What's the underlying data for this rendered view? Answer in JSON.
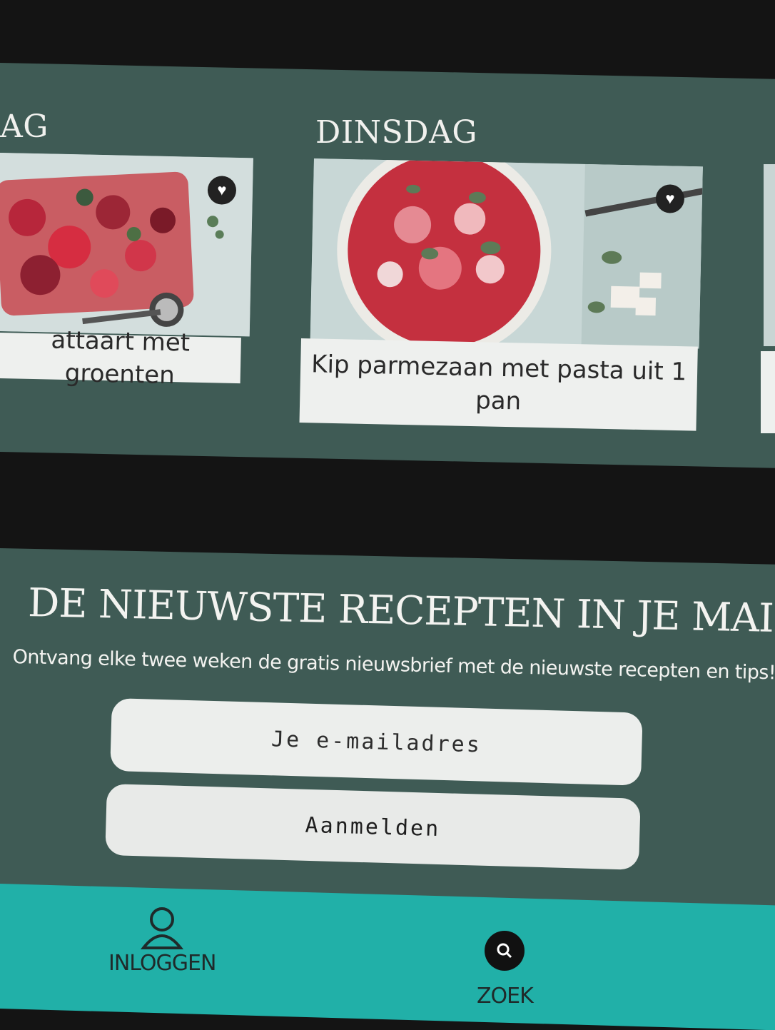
{
  "days": [
    {
      "label": "AG",
      "recipe_title": "attaart met groenten"
    },
    {
      "label": "DINSDAG",
      "recipe_title": "Kip parmezaan met pasta uit 1 pan"
    }
  ],
  "icons": {
    "favorite": "heart-icon",
    "login": "user-icon",
    "search": "search-icon"
  },
  "newsletter": {
    "title": "DE NIEUWSTE RECEPTEN IN JE MAIL?",
    "subtitle": "Ontvang elke twee weken de gratis nieuwsbrief met de nieuwste recepten en tips!",
    "email_placeholder": "Je e-mailadres",
    "submit_label": "Aanmelden"
  },
  "bottom_nav": {
    "login_label": "INLOGGEN",
    "search_label": "ZOEK"
  },
  "colors": {
    "panel": "#3f5b55",
    "nav": "#21b0a8",
    "background": "#141414"
  }
}
